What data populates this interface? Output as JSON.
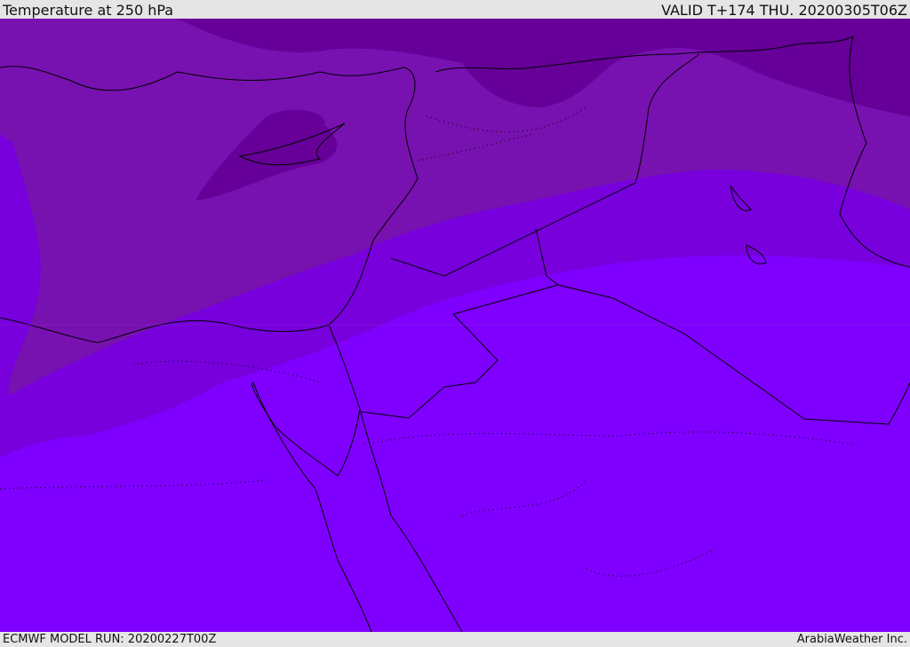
{
  "header": {
    "title": "Temperature at 250 hPa",
    "valid": "VALID T+174 THU. 20200305T06Z"
  },
  "footer": {
    "model_run": "ECMWF MODEL RUN: 20200227T00Z",
    "credit": "ArabiaWeather Inc."
  },
  "colors": {
    "coldest": "#660099",
    "cold": "#7711b0",
    "mid": "#7700dd",
    "warm": "#7f00ff",
    "coast": "#000000"
  }
}
